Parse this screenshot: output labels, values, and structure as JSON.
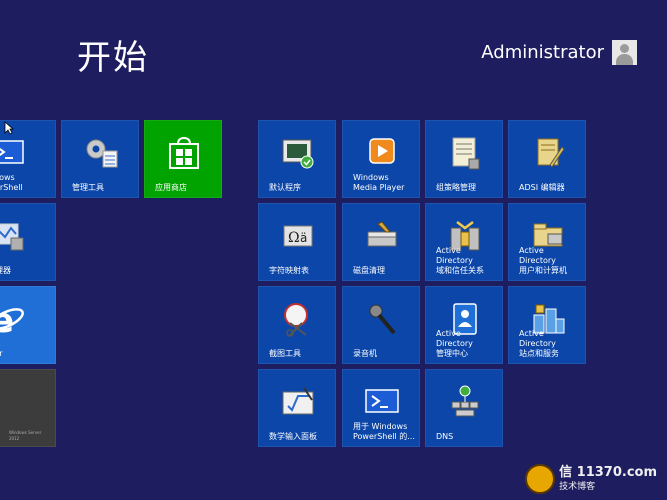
{
  "start": {
    "title": "开始"
  },
  "user": {
    "name": "Administrator"
  },
  "tiles": [
    {
      "id": "powershell",
      "label": "Windows\nPowerShell",
      "icon": "powershell-icon",
      "color": "#0b46a8"
    },
    {
      "id": "admin-tools",
      "label": "管理工具",
      "icon": "admin-tools-icon",
      "color": "#0b46a8"
    },
    {
      "id": "store",
      "label": "应用商店",
      "icon": "store-icon",
      "color": "#00a300"
    },
    {
      "id": "server-manager",
      "label": "务管理器",
      "icon": "server-manager-icon",
      "color": "#0b46a8"
    },
    {
      "id": "ie",
      "label": "ernet\nplorer",
      "icon": "ie-icon",
      "color": "#1f6fd6"
    },
    {
      "id": "desktop",
      "label": "Windows Server 2012",
      "icon": "desktop-icon",
      "color": "#3c3c3c"
    },
    {
      "id": "default-programs",
      "label": "默认程序",
      "icon": "default-programs-icon"
    },
    {
      "id": "media-player",
      "label": "Windows\nMedia Player",
      "icon": "media-player-icon"
    },
    {
      "id": "group-policy",
      "label": "组策略管理",
      "icon": "group-policy-icon"
    },
    {
      "id": "adsi",
      "label": "ADSI 编辑器",
      "icon": "adsi-icon"
    },
    {
      "id": "charmap",
      "label": "字符映射表",
      "icon": "charmap-icon"
    },
    {
      "id": "disk-cleanup",
      "label": "磁盘清理",
      "icon": "disk-cleanup-icon"
    },
    {
      "id": "ad-domains",
      "label": "Active Directory\n域和信任关系",
      "icon": "ad-domains-icon"
    },
    {
      "id": "ad-users",
      "label": "Active Directory\n用户和计算机",
      "icon": "ad-users-icon"
    },
    {
      "id": "snipping",
      "label": "截图工具",
      "icon": "snipping-icon"
    },
    {
      "id": "recorder",
      "label": "录音机",
      "icon": "microphone-icon"
    },
    {
      "id": "ad-admin-center",
      "label": "Active Directory\n管理中心",
      "icon": "ad-admin-center-icon"
    },
    {
      "id": "ad-sites",
      "label": "Active Directory\n站点和服务",
      "icon": "ad-sites-icon"
    },
    {
      "id": "math-input",
      "label": "数学输入面板",
      "icon": "math-input-icon"
    },
    {
      "id": "powershell-modules",
      "label": "用于 Windows\nPowerShell 的...",
      "icon": "powershell-modules-icon"
    },
    {
      "id": "dns",
      "label": "DNS",
      "icon": "dns-icon"
    }
  ],
  "watermark": {
    "text": "信 11370.com",
    "sub": "技术博客"
  }
}
